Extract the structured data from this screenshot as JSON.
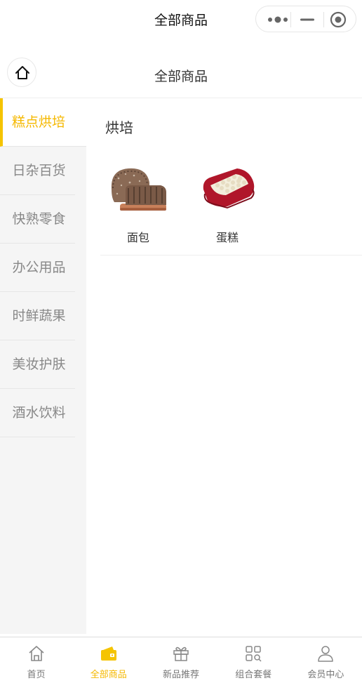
{
  "window": {
    "title": "全部商品"
  },
  "header": {
    "title": "全部商品"
  },
  "sidebar": {
    "items": [
      {
        "label": "糕点烘培",
        "active": true
      },
      {
        "label": "日杂百货",
        "active": false
      },
      {
        "label": "快熟零食",
        "active": false
      },
      {
        "label": "办公用品",
        "active": false
      },
      {
        "label": "时鲜蔬果",
        "active": false
      },
      {
        "label": "美妆护肤",
        "active": false
      },
      {
        "label": "酒水饮料",
        "active": false
      }
    ]
  },
  "main": {
    "section_title": "烘培",
    "products": [
      {
        "name": "面包",
        "icon": "bread-image"
      },
      {
        "name": "蛋糕",
        "icon": "cake-image"
      }
    ]
  },
  "tabbar": {
    "items": [
      {
        "label": "首页",
        "icon": "home-icon"
      },
      {
        "label": "全部商品",
        "icon": "wallet-icon",
        "active": true
      },
      {
        "label": "新品推荐",
        "icon": "gift-icon"
      },
      {
        "label": "组合套餐",
        "icon": "grid-icon"
      },
      {
        "label": "会员中心",
        "icon": "user-icon"
      }
    ]
  },
  "colors": {
    "accent": "#f5c400",
    "active_text": "#f5b800",
    "sidebar_bg": "#f5f5f5"
  }
}
